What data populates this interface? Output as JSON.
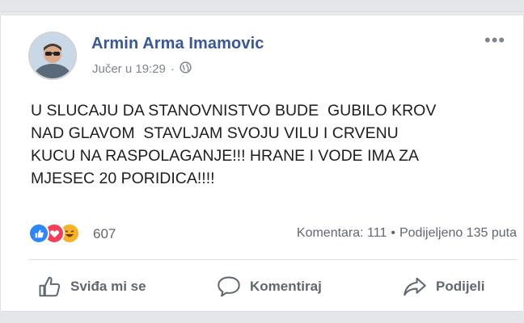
{
  "post": {
    "author": "Armin Arma Imamovic",
    "timestamp": "Jučer u 19:29",
    "separator": "·",
    "privacy_icon": "globe-icon",
    "menu": "•••",
    "lines": [
      "U SLUCAJU DA STANOVNISTVO BUDE  GUBILO KROV",
      "NAD GLAVOM  STAVLJAM SVOJU VILU I CRVENU",
      "KUCU NA RASPOLAGANJE!!! HRANE I VODE IMA ZA",
      "MJESEC 20 PORIDICA!!!!"
    ]
  },
  "reactions": {
    "icons": [
      "like-reaction-icon",
      "love-reaction-icon",
      "haha-reaction-icon"
    ],
    "count": "607"
  },
  "stats": {
    "comments": "Komentara: 111",
    "dot": "•",
    "shares": "Podijeljeno 135 puta"
  },
  "actions": {
    "like": "Sviđa mi se",
    "comment": "Komentiraj",
    "share": "Podijeli"
  },
  "colors": {
    "author": "#385898",
    "text": "#1c1e21",
    "meta": "#7f858d",
    "like_blue": "#2d88ff",
    "love_red": "#f33e58",
    "haha_yellow": "#f7b125"
  }
}
